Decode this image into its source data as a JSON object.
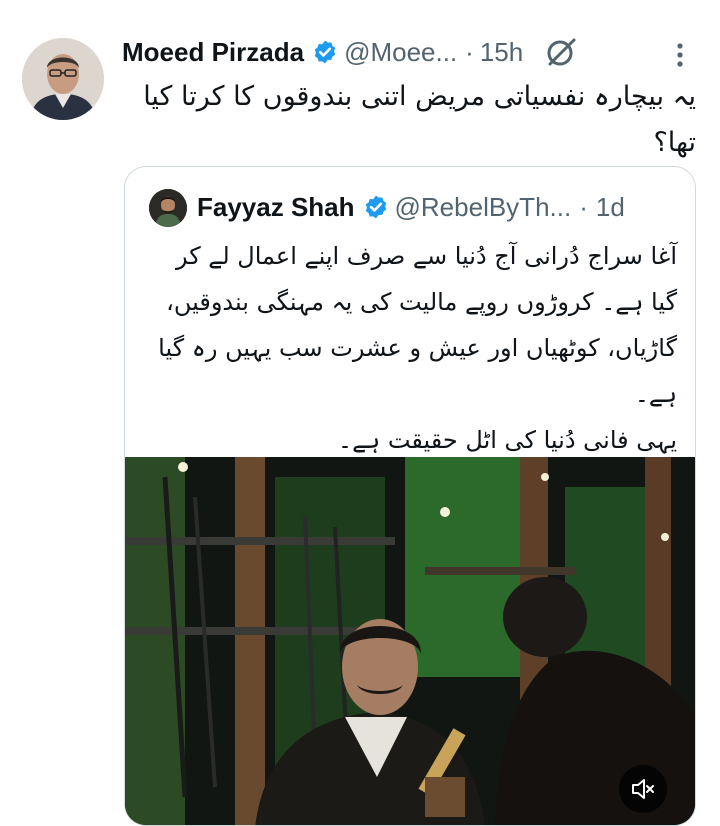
{
  "tweet": {
    "author_name": "Moeed Pirzada",
    "handle": "@Moee...",
    "separator": "·",
    "time": "15h",
    "text": "یہ بیچارہ نفسیاتی مریض اتنی بندوقوں کا کرتا کیا تھا؟",
    "icons": {
      "verified": "verified-badge-icon",
      "grok": "grok-icon",
      "more": "more-vertical-icon"
    }
  },
  "quote": {
    "author_name": "Fayyaz Shah",
    "handle": "@RebelByTh...",
    "separator": "·",
    "time": "1d",
    "text_lines": [
      "آغا سراج دُرانی آج دُنیا سے صرف اپنے اعمال لے کر گیا ہے۔ کروڑوں روپے مالیت کی یہ مہنگی بندوقیں، گاڑیاں، کوٹھیاں اور عیش و عشرت سب یہیں رہ گیا ہے۔",
      "یہی فانی دُنیا کی اٹل حقیقت ہے۔"
    ],
    "video": {
      "muted_icon": "volume-muted-icon"
    }
  },
  "colors": {
    "verified": "#1d9bf0",
    "secondary_text": "#536471",
    "border": "#cfd9de"
  }
}
